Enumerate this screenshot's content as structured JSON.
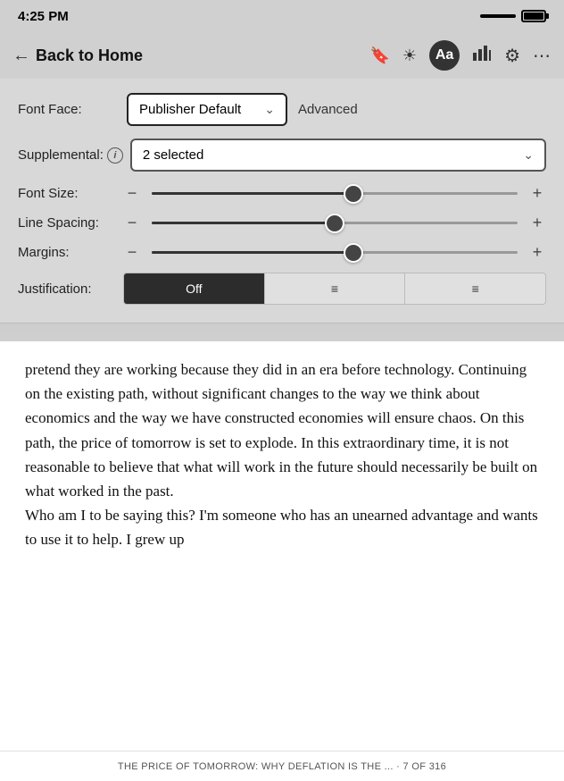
{
  "status_bar": {
    "time": "4:25 PM"
  },
  "nav": {
    "back_label": "Back to Home",
    "icons": {
      "bookmark": "🔖",
      "brightness": "☀",
      "font": "Aa",
      "chart": "📊",
      "settings": "⚙",
      "more": "•••"
    }
  },
  "settings": {
    "font_face_label": "Font Face:",
    "font_face_value": "Publisher Default",
    "advanced_label": "Advanced",
    "supplemental_label": "Supplemental:",
    "supplemental_value": "2 selected",
    "font_size_label": "Font Size:",
    "font_size_percent": 55,
    "line_spacing_label": "Line Spacing:",
    "line_spacing_percent": 50,
    "margins_label": "Margins:",
    "margins_percent": 55,
    "justification_label": "Justification:",
    "just_options": [
      "Off",
      "≡",
      "≡"
    ],
    "just_active": 0
  },
  "book": {
    "paragraph1": "pretend they are working because they did in an era before technology. Continuing on the existing path, without significant changes to the way we think about economics and the way we have constructed economies will ensure chaos. On this path, the price of tomorrow is set to explode. In this extraordinary time, it is not reasonable to believe that what will work in the future should necessarily be built on what worked in the past.",
    "paragraph2": "Who am I to be saying this? I'm someone who has an unearned advantage and wants to use it to help. I grew up",
    "footer": "THE PRICE OF TOMORROW: WHY DEFLATION IS THE ... · 7 OF 316"
  }
}
